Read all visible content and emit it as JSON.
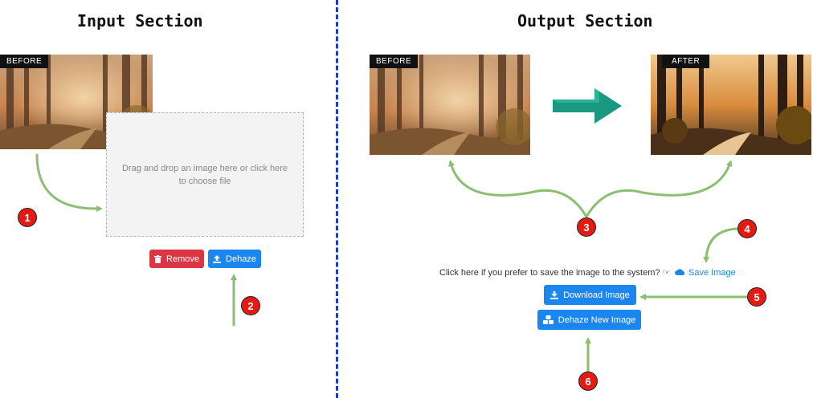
{
  "input_section": {
    "title": "Input Section",
    "before_tag": "BEFORE",
    "dropzone_text": "Drag and drop an image here or click here to choose file",
    "remove_label": "Remove",
    "dehaze_label": "Dehaze"
  },
  "output_section": {
    "title": "Output Section",
    "before_tag": "BEFORE",
    "after_tag": "AFTER",
    "save_prompt": "Click here if you prefer to save the image to the system? ☞",
    "save_label": "Save Image",
    "download_label": "Download Image",
    "dehaze_new_label": "Dehaze New Image"
  },
  "callouts": [
    "1",
    "2",
    "3",
    "4",
    "5",
    "6"
  ],
  "colors": {
    "accent_blue": "#1a86f0",
    "danger_red": "#dc3545",
    "arrow_green": "#8cbf72",
    "badge_red": "#e41b13",
    "divider_blue": "#1d3fbf",
    "teal_arrow": "#1a9880"
  },
  "icons": {
    "remove": "trash-icon",
    "dehaze": "upload-icon",
    "save": "cloud-icon",
    "download": "download-icon",
    "dehaze_new": "cubes-icon",
    "center": "right-arrow-icon"
  }
}
